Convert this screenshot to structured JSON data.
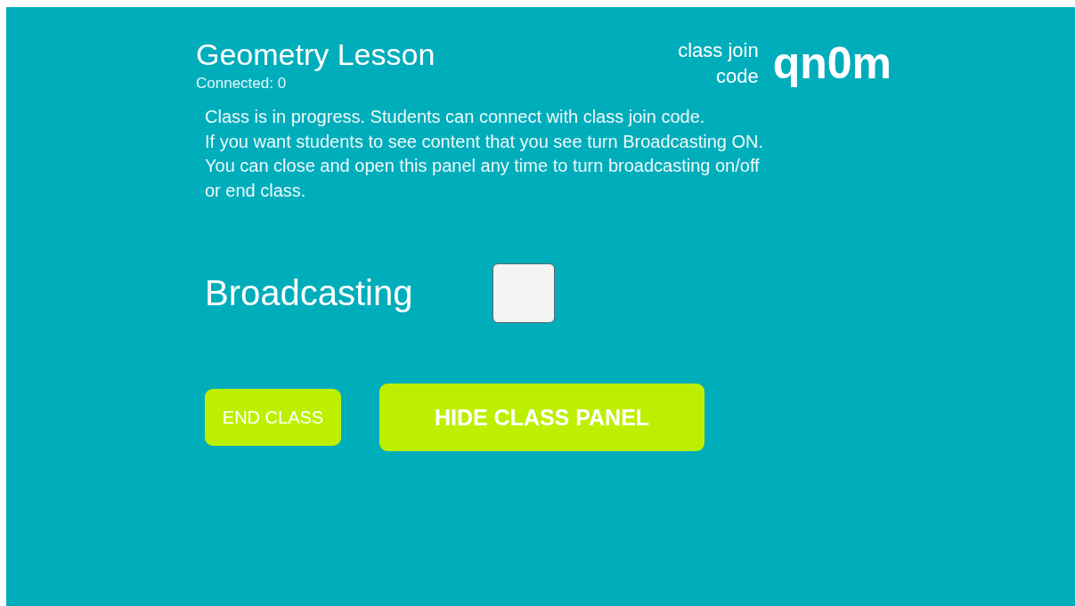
{
  "lesson": {
    "title": "Geometry Lesson",
    "connected": "Connected: 0"
  },
  "join": {
    "label": "class join code",
    "code": "qn0m"
  },
  "message": "Class is in progress. Students can connect with class join code.\nIf you want students to see content that you see turn Broadcasting ON.\nYou can close and open this panel any time to turn broadcasting on/off\nor end class.",
  "broadcasting": {
    "label": "Broadcasting",
    "checked": false
  },
  "buttons": [
    {
      "label": "END CLASS",
      "kind": "secondary"
    },
    {
      "label": "HIDE CLASS PANEL",
      "kind": "primary"
    }
  ]
}
